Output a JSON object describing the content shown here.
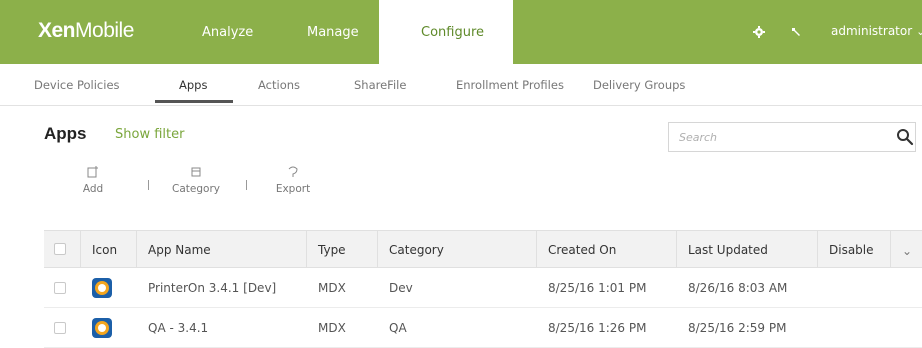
{
  "header": {
    "logo_bold": "Xen",
    "logo_rest": "Mobile",
    "nav": [
      "Analyze",
      "Manage",
      "Configure"
    ],
    "active_nav": "Configure",
    "user": "administrator",
    "icons": [
      "gear-icon",
      "wrench-icon",
      "chevron-down-icon"
    ]
  },
  "subnav": {
    "tabs": [
      "Device Policies",
      "Apps",
      "Actions",
      "ShareFile",
      "Enrollment Profiles",
      "Delivery Groups"
    ],
    "active": "Apps"
  },
  "page": {
    "title": "Apps",
    "show_filter": "Show filter",
    "search_placeholder": "Search"
  },
  "toolbar": {
    "add": "Add",
    "category": "Category",
    "export": "Export",
    "icons": [
      "add-icon",
      "category-icon",
      "export-icon"
    ]
  },
  "table": {
    "columns": [
      "Icon",
      "App Name",
      "Type",
      "Category",
      "Created On",
      "Last Updated",
      "Disable"
    ],
    "rows": [
      {
        "name": "PrinterOn 3.4.1 [Dev]",
        "type": "MDX",
        "category": "Dev",
        "created": "8/25/16 1:01 PM",
        "updated": "8/26/16 8:03 AM"
      },
      {
        "name": "QA - 3.4.1",
        "type": "MDX",
        "category": "QA",
        "created": "8/25/16 1:26 PM",
        "updated": "8/25/16 2:59 PM"
      }
    ]
  },
  "colors": {
    "brand_green": "#8cb04a",
    "link_green": "#7aa63b",
    "header_row_bg": "#f2f2f2"
  }
}
